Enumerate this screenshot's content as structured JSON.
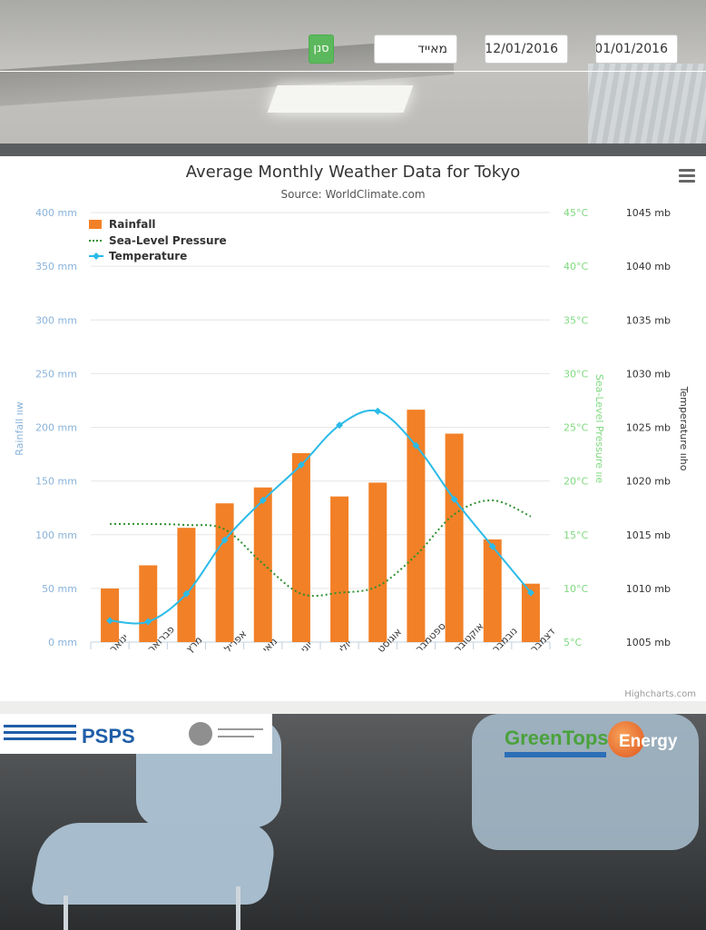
{
  "filters": {
    "date_from": "01/01/2016",
    "date_to": "12/01/2016",
    "sensor": "מאייד",
    "filter_button": "סנן"
  },
  "chart_data": {
    "type": "combo",
    "title": "Average Monthly Weather Data for Tokyo",
    "subtitle": "Source: WorldClimate.com",
    "credits": "Highcharts.com",
    "categories": [
      "ינואר",
      "פברואר",
      "מרץ",
      "אפריל",
      "מאי",
      "יוני",
      "יולי",
      "אוגוסט",
      "ספטמבר",
      "אוקטובר",
      "נובמבר",
      "דצמבר"
    ],
    "series": [
      {
        "name": "Rainfall",
        "type": "column",
        "axis": "rainfall",
        "color": "#f28027",
        "values": [
          49.9,
          71.5,
          106.4,
          129.2,
          144.0,
          176.0,
          135.6,
          148.5,
          216.4,
          194.1,
          95.6,
          54.4
        ]
      },
      {
        "name": "Sea-Level Pressure",
        "type": "spline",
        "dash": "dot",
        "axis": "pressure",
        "color": "#2f8f2f",
        "values": [
          1016,
          1016,
          1015.9,
          1015.5,
          1012.3,
          1009.5,
          1009.6,
          1010.2,
          1013.1,
          1016.9,
          1018.2,
          1016.7
        ]
      },
      {
        "name": "Temperature",
        "type": "spline",
        "axis": "temperature",
        "color": "#2bbbe8",
        "values": [
          7.0,
          6.9,
          9.5,
          14.5,
          18.2,
          21.5,
          25.2,
          26.5,
          23.3,
          18.3,
          13.9,
          9.6
        ]
      }
    ],
    "axes": {
      "rainfall": {
        "label": "Rainfall ‪ו‬ו‬w",
        "unit": "mm",
        "min": 0,
        "max": 400,
        "ticks": [
          0,
          50,
          100,
          150,
          200,
          250,
          300,
          350,
          400
        ],
        "color": "#89b3d9"
      },
      "temperature": {
        "label": "Sea-Level Pressure ‪ו‬ו‬e",
        "unit": "°C",
        "min": 5,
        "max": 45,
        "ticks": [
          5,
          10,
          15,
          20,
          25,
          30,
          35,
          40,
          45
        ],
        "color": "#7fd97f"
      },
      "pressure": {
        "label": "Temperature ‪ו‬ו‬ho",
        "unit": "mb",
        "min": 1005,
        "max": 1045,
        "ticks": [
          1005,
          1010,
          1015,
          1020,
          1025,
          1030,
          1035,
          1040,
          1045
        ],
        "color": "#333333"
      }
    },
    "legend_position": "top-left",
    "grid": true
  },
  "colors": {
    "filter_button": "#5cb85c",
    "rainfall": "#f28027",
    "pressure": "#2f8f2f",
    "temperature": "#2bbbe8"
  },
  "icons": {
    "chart_menu": "hamburger-icon"
  },
  "logos": {
    "left": "PSPS",
    "right_green": "GreenTops",
    "right_energy": "Energy"
  }
}
